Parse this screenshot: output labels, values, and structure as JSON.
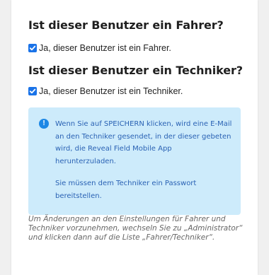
{
  "driver": {
    "heading": "Ist dieser Benutzer ein Fahrer?",
    "checkbox_label": "Ja, dieser Benutzer ist ein Fahrer.",
    "checked": true
  },
  "technician": {
    "heading": "Ist dieser Benutzer ein Techniker?",
    "checkbox_label": "Ja, dieser Benutzer ist ein Techniker.",
    "checked": true
  },
  "info": {
    "icon": "info-icon",
    "paragraph_1": "Wenn Sie auf SPEICHERN klicken, wird eine E-Mail an den Techniker gesendet, in der dieser gebeten wird, die Reveal Field Mobile App herunterzuladen.",
    "paragraph_2": "Sie müssen dem Techniker ein Passwort bereitstellen."
  },
  "footnote": "Um Änderungen an den Einstellungen für Fahrer und Techniker vorzunehmen, wechseln Sie zu „Administrator“ und klicken dann auf die Liste „Fahrer/Techniker“.",
  "colors": {
    "checkbox": "#1a73e8",
    "info_background": "#cdebfb",
    "info_text": "#2a62b4",
    "info_icon": "#1e88e5"
  }
}
